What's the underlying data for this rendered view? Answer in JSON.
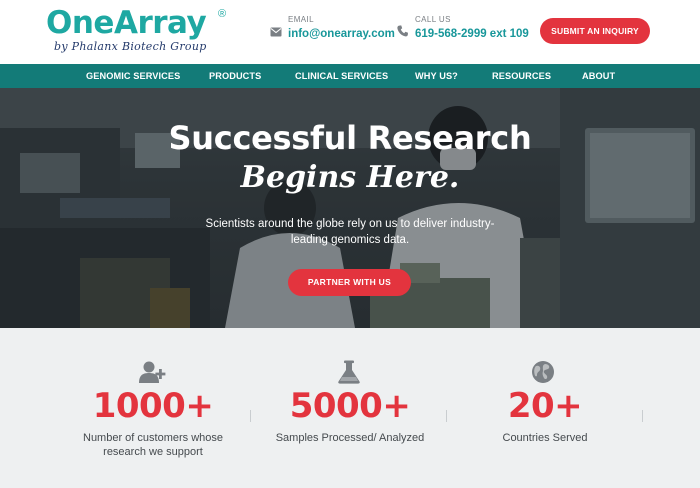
{
  "brand": {
    "name": "OneArray",
    "registered_mark": "®",
    "tagline": "by Phalanx Biotech Group",
    "primary_color": "#1ea8a2",
    "accent_color": "#e3343e",
    "nav_color": "#137b78"
  },
  "header": {
    "email": {
      "label": "EMAIL",
      "value": "info@onearray.com",
      "icon": "envelope-icon"
    },
    "phone": {
      "label": "CALL US",
      "value": "619-568-2999 ext 109",
      "icon": "phone-icon"
    },
    "inquiry_button": "SUBMIT AN INQUIRY"
  },
  "nav": {
    "items": [
      {
        "label": "GENOMIC SERVICES"
      },
      {
        "label": "PRODUCTS"
      },
      {
        "label": "CLINICAL SERVICES"
      },
      {
        "label": "WHY US?"
      },
      {
        "label": "RESOURCES"
      },
      {
        "label": "ABOUT"
      }
    ]
  },
  "hero": {
    "title": "Successful Research",
    "script_title": "Begins Here.",
    "text": "Scientists around the globe rely on us to deliver industry-leading genomics data.",
    "button": "PARTNER WITH US"
  },
  "stats": [
    {
      "icon": "add-user-icon",
      "value": "1000+",
      "label": "Number of customers whose research we support"
    },
    {
      "icon": "flask-icon",
      "value": "5000+",
      "label": "Samples Processed/ Analyzed"
    },
    {
      "icon": "globe-icon",
      "value": "20+",
      "label": "Countries Served"
    }
  ]
}
